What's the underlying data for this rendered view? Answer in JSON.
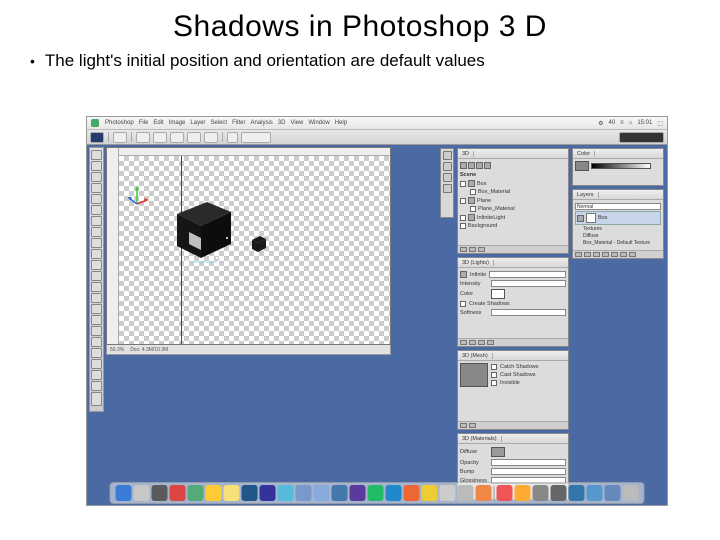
{
  "slide": {
    "title": "Shadows in Photoshop 3 D",
    "bullet": "The light's initial position and orientation are default values"
  },
  "menubar": {
    "app": "Photoshop",
    "items": [
      "File",
      "Edit",
      "Image",
      "Layer",
      "Select",
      "Filter",
      "Analysis",
      "3D",
      "View",
      "Window",
      "Help"
    ],
    "right": [
      "⚙",
      "40",
      "≡",
      "⌂",
      "15:01",
      "⬚"
    ]
  },
  "statusbar": {
    "zoom": "50.3%",
    "info": "Doc: 4.3M/10.3M"
  },
  "panels": {
    "color": {
      "tab": "Color"
    },
    "scene": {
      "tab": "3D",
      "heading": "Scene",
      "items": [
        "Box",
        "Box_Material",
        "Plane",
        "Plane_Material",
        "InfiniteLight",
        "Background"
      ]
    },
    "layers": {
      "tab": "Layers",
      "blend": "Normal",
      "layer": "Box",
      "sub": [
        "Textures",
        "Diffuse",
        "Box_Material - Default Texture"
      ]
    },
    "lights": {
      "tab": "3D (Lights)",
      "type": "Infinite",
      "fields": [
        "Intensity",
        "Color",
        "Create Shadows",
        "Softness"
      ]
    },
    "mesh": {
      "tab": "3D (Mesh)",
      "fields": [
        "Catch Shadows",
        "Cast Shadows",
        "Invisible"
      ]
    },
    "materials": {
      "tab": "3D (Materials)",
      "fields": [
        "Diffuse",
        "Opacity",
        "Bump",
        "Glossiness"
      ]
    }
  },
  "dock_colors": [
    "#3a7bd5",
    "#c7c7c7",
    "#5b5b5b",
    "#d44",
    "#5a7",
    "#fc3",
    "#f7e07a",
    "#258",
    "#339",
    "#5bd",
    "#79c",
    "#8ad",
    "#47a",
    "#5a3a9a",
    "#2b6",
    "#28c",
    "#e63",
    "#ec3",
    "#ccc",
    "#bbb",
    "#e84",
    "#e55",
    "#fa3",
    "#888",
    "#666",
    "#37a",
    "#59c",
    "#68b",
    "#bbb"
  ]
}
